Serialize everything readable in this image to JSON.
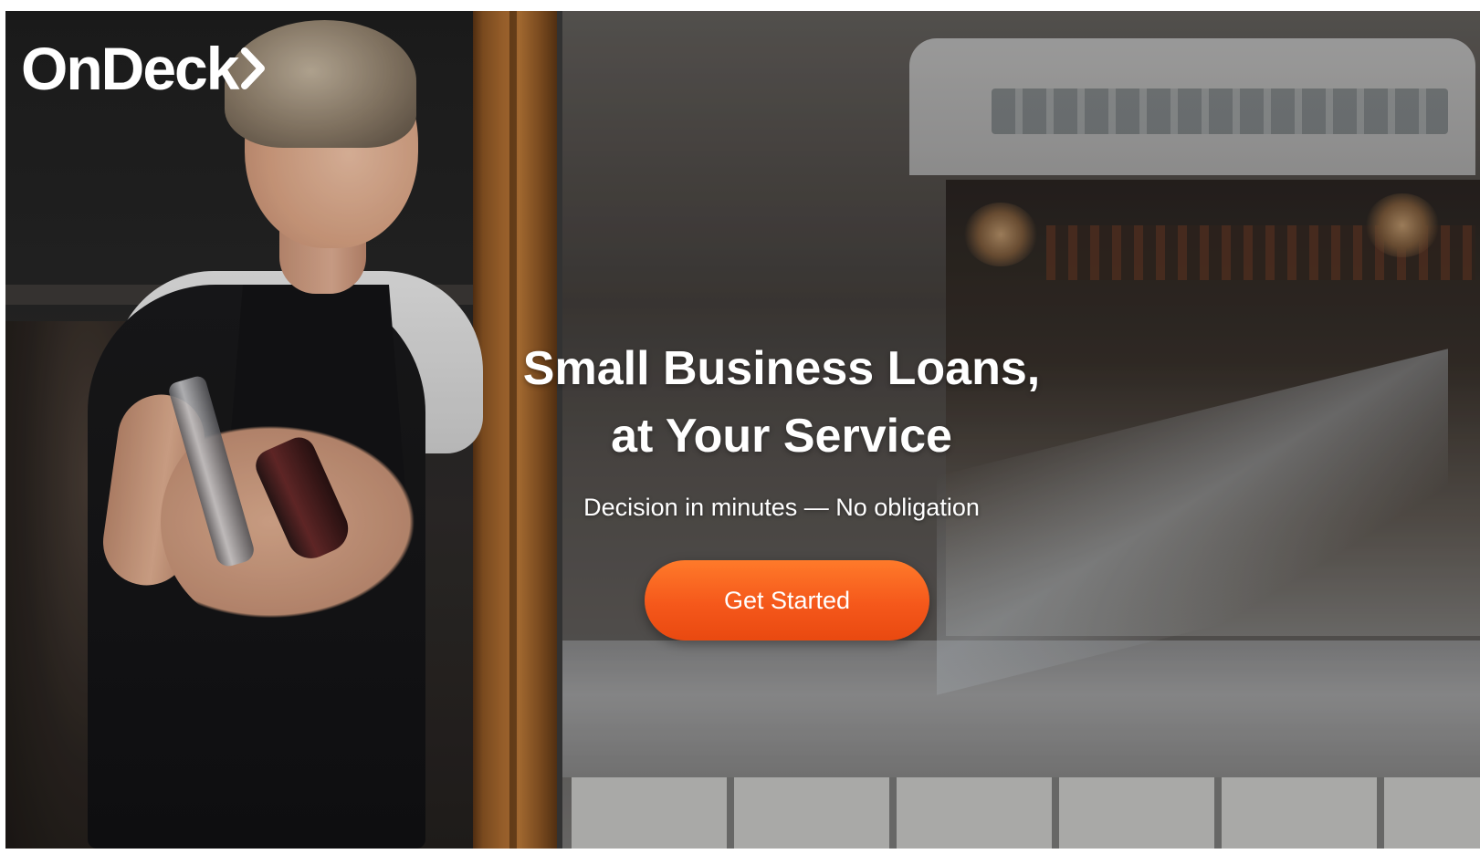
{
  "brand": {
    "logo_text": "OnDeck",
    "logo_icon": "chevron-right-icon",
    "accent_color": "#f5581b"
  },
  "hero": {
    "headline_line1": "Small Business Loans,",
    "headline_line2": "at Your Service",
    "subheadline": "Decision in minutes — No obligation",
    "cta_label": "Get Started"
  }
}
